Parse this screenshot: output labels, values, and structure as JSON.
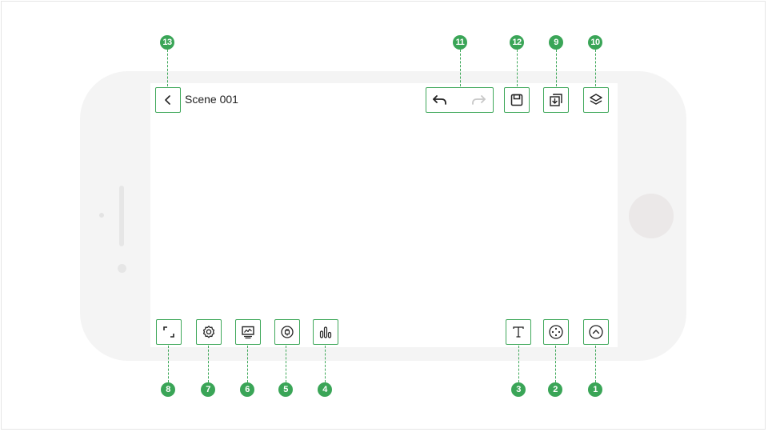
{
  "scene": {
    "title": "Scene 001"
  },
  "icons": {
    "back": "chevron-left-icon",
    "undo": "undo-icon",
    "redo": "redo-icon",
    "save": "floppy-disk-icon",
    "import": "import-icon",
    "layers": "layers-icon",
    "fullscreen": "fullscreen-icon",
    "settings": "gear-icon",
    "monitor": "monitor-icon",
    "plugin": "plug-icon",
    "chart": "bar-chart-icon",
    "text": "text-icon",
    "navigate": "navigation-dots-icon",
    "expand": "chevron-up-icon"
  },
  "annotations": {
    "n1": "1",
    "n2": "2",
    "n3": "3",
    "n4": "4",
    "n5": "5",
    "n6": "6",
    "n7": "7",
    "n8": "8",
    "n9": "9",
    "n10": "10",
    "n11": "11",
    "n12": "12",
    "n13": "13"
  },
  "colors": {
    "accent": "#3aa557",
    "phone_body": "#f4f4f4",
    "redo_disabled": "#c8c8c8"
  }
}
